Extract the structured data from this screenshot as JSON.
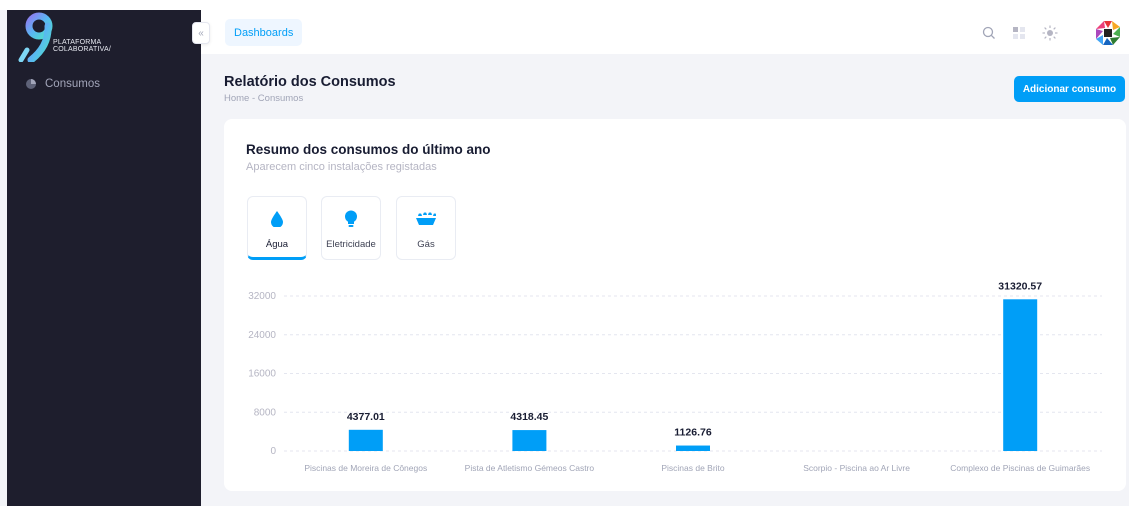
{
  "brand": {
    "logo_line1": "PLATAFORMA",
    "logo_line2": "COLABORATIVA/"
  },
  "sidebar": {
    "items": [
      {
        "label": "Consumos",
        "icon": "pie-chart-icon"
      }
    ]
  },
  "header": {
    "dashboards_label": "Dashboards",
    "icons": [
      "search-icon",
      "apps-grid-icon",
      "sun-icon",
      "user-avatar-logo"
    ]
  },
  "toolbar": {
    "title": "Relatório dos Consumos",
    "breadcrumb_home": "Home",
    "breadcrumb_sep": "-",
    "breadcrumb_current": "Consumos",
    "add_label": "Adicionar consumo"
  },
  "card": {
    "title": "Resumo dos consumos do último ano",
    "subtitle": "Aparecem cinco instalações registadas",
    "tabs": [
      {
        "label": "Água",
        "icon": "water-drop-icon",
        "active": true
      },
      {
        "label": "Eletricidade",
        "icon": "lightbulb-icon",
        "active": false
      },
      {
        "label": "Gás",
        "icon": "gas-flame-icon",
        "active": false
      }
    ]
  },
  "colors": {
    "accent": "#009ef7",
    "sidebar": "#1e1e2d"
  },
  "chart_data": {
    "type": "bar",
    "categories": [
      "Piscinas de Moreira de Cônegos",
      "Pista de Atletismo Gémeos Castro",
      "Piscinas de Brito",
      "Scorpio - Piscina ao Ar Livre",
      "Complexo de Piscinas de Guimarães"
    ],
    "values": [
      4377.01,
      4318.45,
      1126.76,
      0,
      31320.57
    ],
    "value_labels": [
      "4377.01",
      "4318.45",
      "1126.76",
      "",
      "31320.57"
    ],
    "yticks": [
      "0",
      "8000",
      "16000",
      "24000",
      "32000"
    ],
    "ylim": [
      0,
      32000
    ],
    "grid": true
  }
}
